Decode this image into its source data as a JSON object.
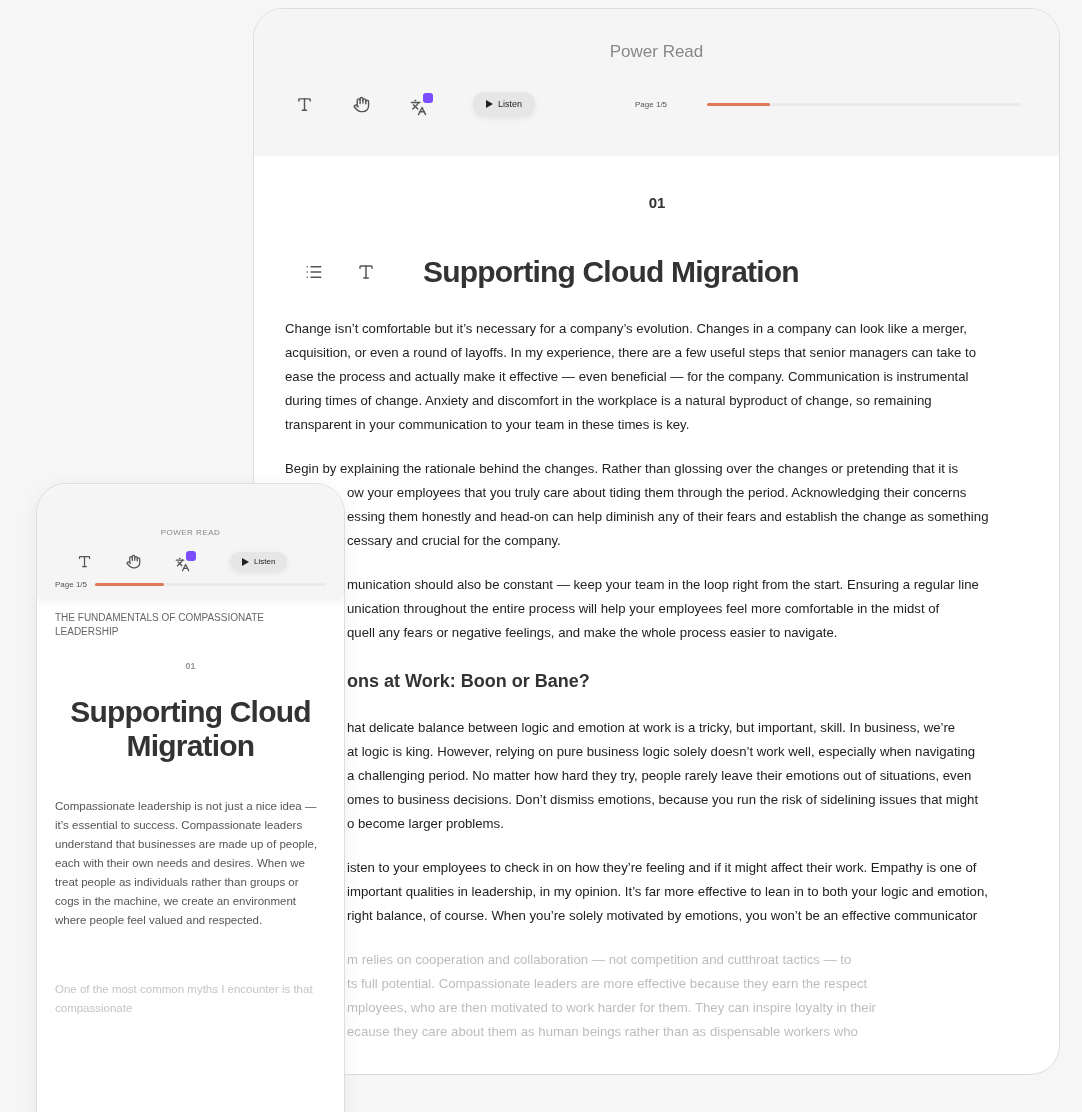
{
  "tablet": {
    "title": "Power Read",
    "toolbar": {
      "listen": "Listen",
      "page": "Page 1/5",
      "level": 0.2
    },
    "chapter": "01",
    "heading": "Supporting Cloud Migration",
    "blocks": [
      {
        "kind": "paragraph",
        "faded": false,
        "lines": [
          {
            "text": "Change isn’t comfortable but it’s necessary for a company’s evolution. Changes in a company can look like a merger,"
          },
          {
            "text": "acquisition, or even a round of layoffs. In my experience, there are a few useful steps that senior managers can take to"
          },
          {
            "text": "ease the process and actually make it effective — even beneficial — for the company. Communication is instrumental"
          },
          {
            "text": "during times of change. Anxiety and discomfort in the workplace is a natural byproduct of change, so remaining"
          },
          {
            "text": "transparent in your communication to your team in these times is key."
          }
        ]
      },
      {
        "kind": "paragraph",
        "faded": false,
        "lines": [
          {
            "text": "Begin by explaining the rationale behind the changes. Rather than glossing over the changes or pretending that it is"
          },
          {
            "text": "ow your employees that you truly care about tiding them through the period. Acknowledging their concerns",
            "cut": true
          },
          {
            "text": "essing them honestly and head-on can help diminish any of their fears and establish the change as something",
            "cut": true
          },
          {
            "text": "cessary and crucial for the company.",
            "cut": true
          }
        ]
      },
      {
        "kind": "paragraph",
        "faded": false,
        "lines": [
          {
            "text": "munication should also be constant — keep your team in the loop right from the start. Ensuring a regular line",
            "cut": true
          },
          {
            "text": "unication throughout the entire process will help your employees feel more comfortable in the midst of",
            "cut": true
          },
          {
            "text": "quell any fears or negative feelings, and make the whole process easier to navigate.",
            "cut": true
          }
        ]
      },
      {
        "kind": "heading",
        "text": "ons at Work: Boon or Bane?",
        "cut": true
      },
      {
        "kind": "paragraph",
        "faded": false,
        "lines": [
          {
            "text": "hat delicate balance between logic and emotion at work is a tricky, but important, skill. In business, we’re",
            "cut": true
          },
          {
            "text": "at logic is king. However, relying on pure business logic solely doesn’t work well, especially when navigating",
            "cut": true
          },
          {
            "text": "a challenging period. No matter how hard they try, people rarely leave their emotions out of situations, even",
            "cut": true
          },
          {
            "text": "omes to business decisions. Don’t dismiss emotions, because you run the risk of sidelining issues that might",
            "cut": true
          },
          {
            "text": "o become larger problems.",
            "cut": true
          }
        ]
      },
      {
        "kind": "paragraph",
        "faded": false,
        "lines": [
          {
            "text": "isten to your employees to check in on how they’re feeling and if it might affect their work. Empathy is one of",
            "cut": true
          },
          {
            "text": "important qualities in leadership, in my opinion. It’s far more effective to lean in to both your logic and emotion,",
            "cut": true
          },
          {
            "text": "right balance, of course. When you’re solely motivated by emotions, you won’t be an effective communicator",
            "cut": true
          }
        ]
      },
      {
        "kind": "paragraph",
        "faded": true,
        "lines": [
          {
            "text": "m relies on cooperation and collaboration — not competition and cutthroat tactics — to",
            "cut": true
          },
          {
            "text": "ts full potential. Compassionate leaders are more effective because they earn the respect",
            "cut": true
          },
          {
            "text": "mployees, who are then motivated to work harder for them. They can inspire loyalty in their",
            "cut": true
          },
          {
            "text": "ecause they care about them as human beings rather than as dispensable workers who",
            "cut": true
          }
        ]
      }
    ]
  },
  "phone": {
    "title": "POWER READ",
    "toolbar": {
      "listen": "Listen",
      "page": "Page 1/5",
      "level": 0.3
    },
    "book": "THE FUNDAMENTALS OF COMPASSIONATE LEADERSHIP",
    "chapter": "01",
    "heading": "Supporting Cloud Migration",
    "paragraphs": [
      {
        "text": "Compassionate leadership is not just a nice idea — it’s essential to success. Compassionate leaders understand that businesses are made up of people, each with their own needs and desires. When we treat people as individuals rather than groups or cogs in the machine, we create an environment where people feel valued and respected.",
        "faded": false
      },
      {
        "text": "One of the most common myths I encounter is that compassionate",
        "faded": true
      }
    ]
  }
}
